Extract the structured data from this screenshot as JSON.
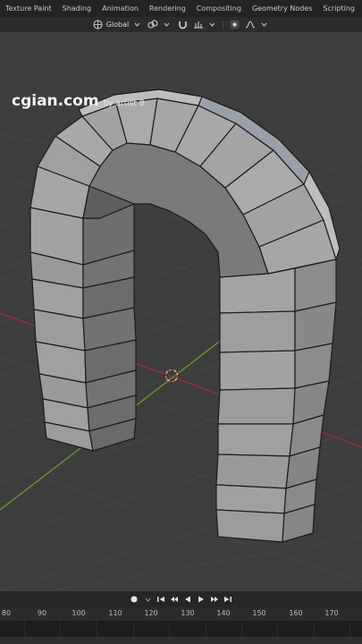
{
  "workspace_tabs": [
    "Texture Paint",
    "Shading",
    "Animation",
    "Rendering",
    "Compositing",
    "Geometry Nodes",
    "Scripting"
  ],
  "add_tab_label": "+",
  "header": {
    "orientation_label": "Global",
    "orientation_icon": "globe-axes-icon",
    "snap_icon": "magnet-icon",
    "proportional_icon": "proportional-edit-icon"
  },
  "watermark": {
    "brand": "cgian.com",
    "author": "by artist B"
  },
  "timeline": {
    "frame_ticks": [
      80,
      90,
      100,
      110,
      120,
      130,
      140,
      150,
      160,
      170
    ]
  },
  "colors": {
    "viewport_bg": "#3d3d3d",
    "x_axis": "#a02a3a",
    "y_axis": "#6a9a2a",
    "mesh_face": "#9c9c9c",
    "mesh_edge": "#1c1c1c"
  }
}
